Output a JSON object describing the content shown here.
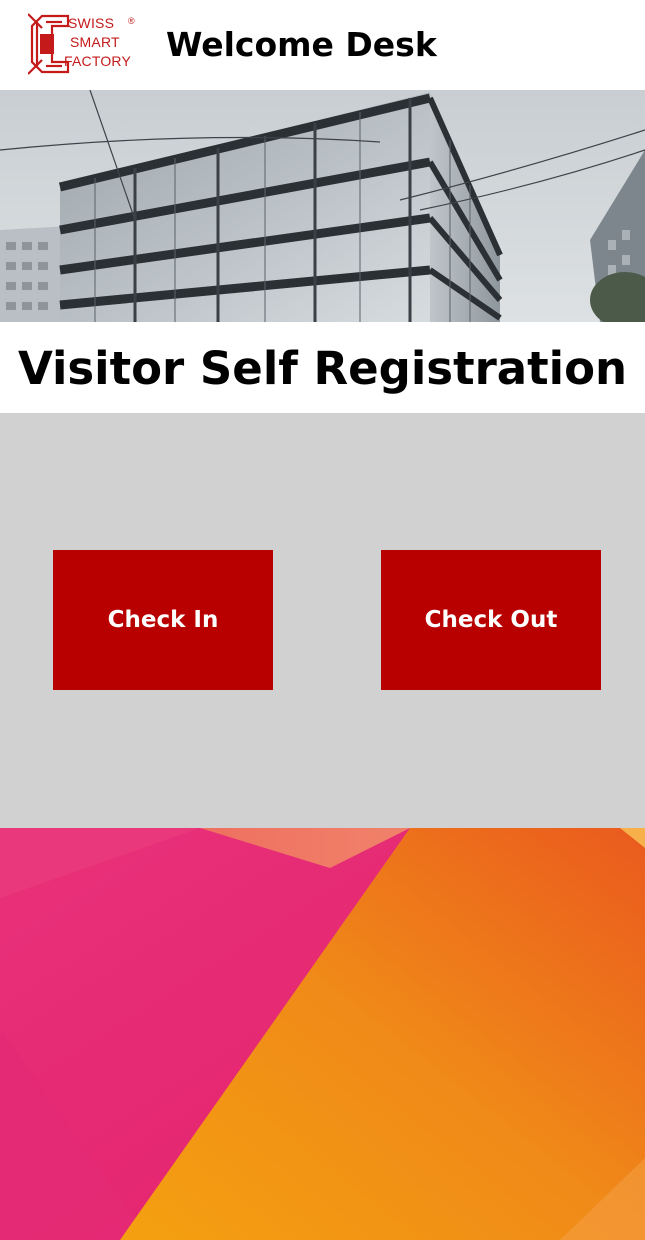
{
  "header": {
    "logo": {
      "line1": "SWISS",
      "line2": "SMART",
      "line3": "FACTORY",
      "registered": "®"
    },
    "title": "Welcome Desk"
  },
  "hero": {
    "image": "office-building-photo"
  },
  "main": {
    "title": "Visitor Self Registration",
    "buttons": {
      "check_in": "Check In",
      "check_out": "Check Out"
    }
  },
  "colors": {
    "brand_red": "#b80000",
    "logo_red": "#c41a1a",
    "panel_gray": "#d1d1d1",
    "gradient_pink": "#e8206e",
    "gradient_orange": "#f28a16"
  },
  "icons": [
    "swiss-smart-factory-logo-mark"
  ]
}
